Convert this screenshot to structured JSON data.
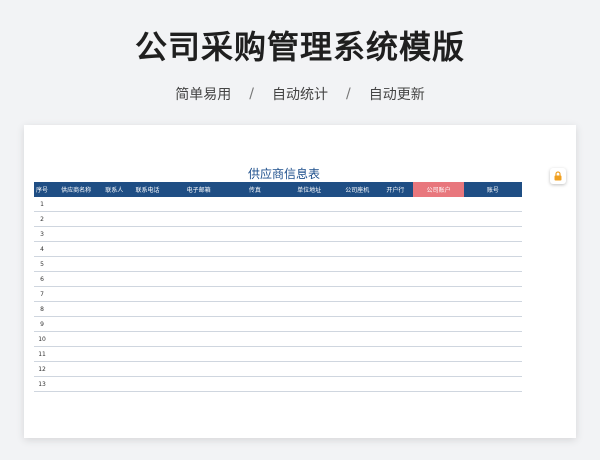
{
  "header": {
    "title": "公司采购管理系统模版",
    "tags": [
      "简单易用",
      "自动统计",
      "自动更新"
    ],
    "separator": "/"
  },
  "sheet": {
    "title": "供应商信息表",
    "columns": [
      "序号",
      "供应商名称",
      "联系人",
      "联系电话",
      "电子邮箱",
      "传真",
      "单位地址",
      "公司座机",
      "开户行",
      "公司账户",
      "账号"
    ],
    "highlight_column": "公司账户",
    "rows": [
      "1",
      "2",
      "3",
      "4",
      "5",
      "6",
      "7",
      "8",
      "9",
      "10",
      "11",
      "12",
      "13"
    ]
  },
  "colors": {
    "header_bg": "#1f4e84",
    "highlight_bg": "#e8777d",
    "title_color": "#1d4f8c",
    "lock_icon": "#f0a020"
  },
  "icons": {
    "side_badge": "lock-icon"
  }
}
